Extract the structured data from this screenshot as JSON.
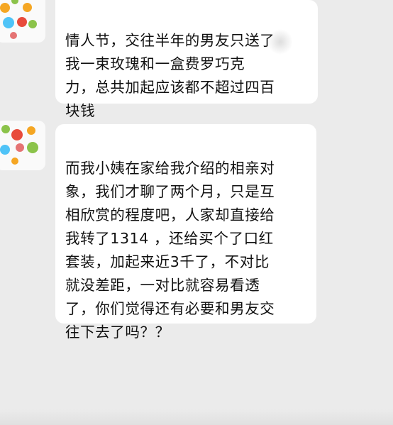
{
  "messages": [
    {
      "text": "情人节，交往半年的男友只送了\n我一束玫瑰和一盒费罗巧克\n力，总共加起应该都不超过四百\n块钱"
    },
    {
      "text": "而我小姨在家给我介绍的相亲对\n象，我们才聊了两个月，只是互\n相欣赏的程度吧，人家却直接给\n我转了1314 ，还给买个了口红\n套装，加起来近3千了，不对比\n就没差距，一对比就容易看透\n了，你们觉得还有必要和男友交\n往下去了吗？？"
    }
  ],
  "colors": {
    "background": "#ebebeb",
    "bubble": "#ffffff",
    "text": "#111111",
    "avatar_dots": [
      "#e84b3c",
      "#f5a623",
      "#8bc34a",
      "#4fc3f7",
      "#e57373"
    ]
  }
}
